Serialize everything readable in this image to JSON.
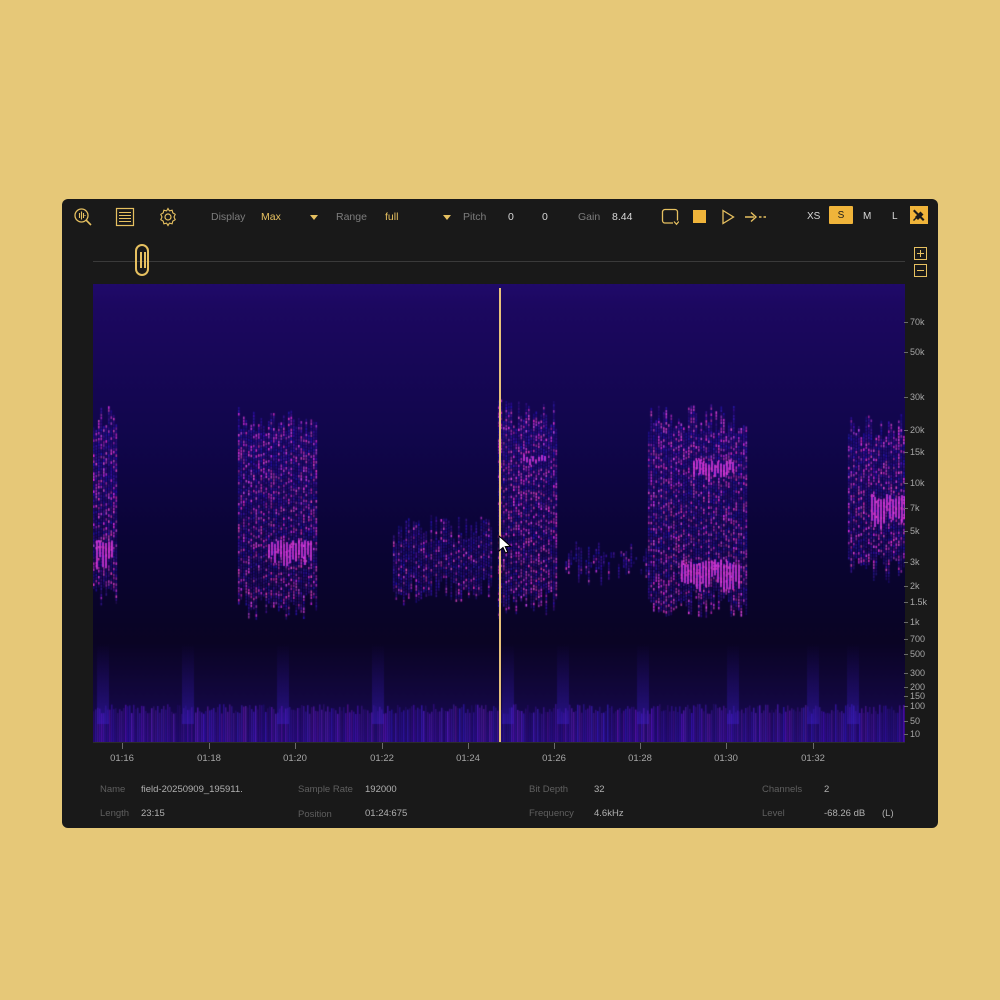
{
  "toolbar": {
    "display_label": "Display",
    "display_value": "Max",
    "range_label": "Range",
    "range_value": "full",
    "pitch_label": "Pitch",
    "pitch_value_1": "0",
    "pitch_value_2": "0",
    "gain_label": "Gain",
    "gain_value": "8.44",
    "sizes": [
      "XS",
      "S",
      "M",
      "L"
    ],
    "active_size": "S",
    "icons": [
      "waveform-search-icon",
      "list-icon",
      "gear-icon",
      "loop-icon",
      "stop-icon",
      "play-icon",
      "skip-forward-icon",
      "pin-icon"
    ]
  },
  "frequency_axis": {
    "ticks": [
      "70k",
      "50k",
      "30k",
      "20k",
      "15k",
      "10k",
      "7k",
      "5k",
      "3k",
      "2k",
      "1.5k",
      "1k",
      "700",
      "500",
      "300",
      "200",
      "150",
      "100",
      "50",
      "10"
    ]
  },
  "time_axis": {
    "ticks": [
      "01:16",
      "01:18",
      "01:20",
      "01:22",
      "01:24",
      "01:26",
      "01:28",
      "01:30",
      "01:32"
    ]
  },
  "info": {
    "name_label": "Name",
    "name_value": "field-20250909_195911.",
    "length_label": "Length",
    "length_value": "23:15",
    "sample_rate_label": "Sample Rate",
    "sample_rate_value": "192000",
    "position_label": "Position",
    "position_value": "01:24:675",
    "bit_depth_label": "Bit Depth",
    "bit_depth_value": "32",
    "frequency_label": "Frequency",
    "frequency_value": "4.6kHz",
    "channels_label": "Channels",
    "channels_value": "2",
    "level_label": "Level",
    "level_value": "-68.26 dB",
    "level_channel": "(L)"
  },
  "colors": {
    "accent": "#f0b43a",
    "panel": "#191919",
    "background": "#e6c878",
    "cursor": "#e8c27a",
    "spectrogram_low": "#0b0420",
    "spectrogram_mid": "#2a10c0",
    "spectrogram_high": "#e040e0"
  }
}
